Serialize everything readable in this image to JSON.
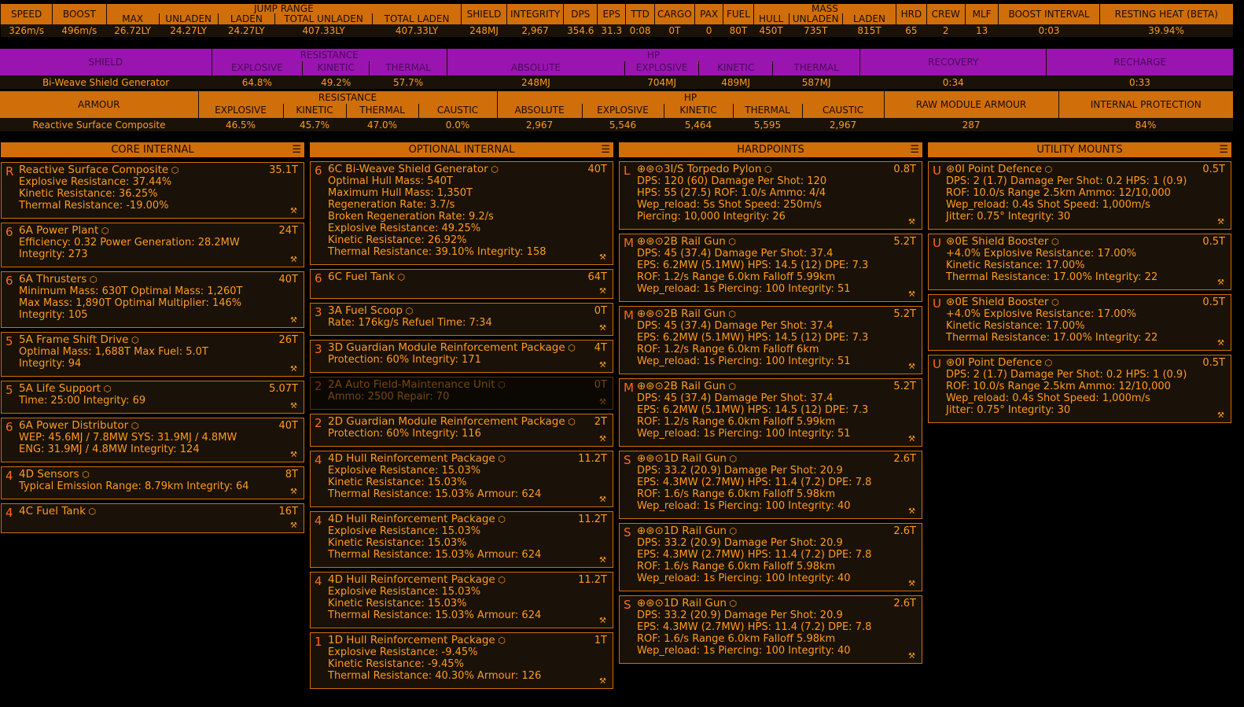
{
  "summary": {
    "group_jump": "JUMP RANGE",
    "group_mass": "MASS",
    "headers": [
      "SPEED",
      "BOOST",
      "MAX",
      "UNLADEN",
      "LADEN",
      "TOTAL UNLADEN",
      "TOTAL LADEN",
      "SHIELD",
      "INTEGRITY",
      "DPS",
      "EPS",
      "TTD",
      "CARGO",
      "PAX",
      "FUEL",
      "HULL",
      "UNLADEN",
      "LADEN",
      "HRD",
      "CREW",
      "MLF",
      "BOOST INTERVAL",
      "RESTING HEAT (BETA)"
    ],
    "values": [
      "326m/s",
      "496m/s",
      "26.72LY",
      "24.27LY",
      "24.27LY",
      "407.33LY",
      "407.33LY",
      "248MJ",
      "2,967",
      "354.6",
      "31.3",
      "0:08",
      "0T",
      "0",
      "80T",
      "450T",
      "735T",
      "815T",
      "65",
      "2",
      "13",
      "0:03",
      "39.94%"
    ]
  },
  "shield": {
    "label": "SHIELD",
    "resistance": "RESISTANCE",
    "hp": "HP",
    "recovery": "RECOVERY",
    "recharge": "RECHARGE",
    "sub": [
      "EXPLOSIVE",
      "KINETIC",
      "THERMAL",
      "ABSOLUTE",
      "EXPLOSIVE",
      "KINETIC",
      "THERMAL"
    ],
    "name": "Bi-Weave Shield Generator",
    "values": [
      "64.8%",
      "49.2%",
      "57.7%",
      "248MJ",
      "704MJ",
      "489MJ",
      "587MJ",
      "0:34",
      "0:33"
    ]
  },
  "armour": {
    "label": "ARMOUR",
    "resistance": "RESISTANCE",
    "hp": "HP",
    "raw": "RAW MODULE ARMOUR",
    "internal": "INTERNAL PROTECTION",
    "sub": [
      "EXPLOSIVE",
      "KINETIC",
      "THERMAL",
      "CAUSTIC",
      "ABSOLUTE",
      "EXPLOSIVE",
      "KINETIC",
      "THERMAL",
      "CAUSTIC"
    ],
    "name": "Reactive Surface Composite",
    "values": [
      "46.5%",
      "45.7%",
      "47.0%",
      "0.0%",
      "2,967",
      "5,546",
      "5,464",
      "5,595",
      "2,967",
      "287",
      "84%"
    ]
  },
  "columns": [
    {
      "title": "CORE INTERNAL",
      "slots": [
        {
          "cls": "R",
          "name": "Reactive Surface Composite",
          "mass": "35.1T",
          "lines": [
            "Explosive Resistance: 37.44%",
            "Kinetic Resistance: 36.25%",
            "Thermal Resistance: -19.00%"
          ]
        },
        {
          "cls": "6",
          "name": "6A Power Plant",
          "mass": "24T",
          "lines": [
            "Efficiency: 0.32   Power Generation: 28.2MW",
            "Integrity: 273"
          ]
        },
        {
          "cls": "6",
          "name": "6A Thrusters",
          "mass": "40T",
          "lines": [
            "Minimum Mass: 630T   Optimal Mass: 1,260T",
            "Max Mass: 1,890T   Optimal Multiplier: 146%",
            "Integrity: 105"
          ]
        },
        {
          "cls": "5",
          "name": "5A Frame Shift Drive",
          "mass": "26T",
          "lines": [
            "Optimal Mass: 1,688T   Max Fuel: 5.0T",
            "Integrity: 94"
          ]
        },
        {
          "cls": "5",
          "name": "5A Life Support",
          "mass": "5.07T",
          "lines": [
            "Time: 25:00   Integrity: 69"
          ]
        },
        {
          "cls": "6",
          "name": "6A Power Distributor",
          "mass": "40T",
          "lines": [
            "WEP: 45.6MJ / 7.8MW   SYS: 31.9MJ / 4.8MW",
            "ENG: 31.9MJ / 4.8MW   Integrity: 124"
          ]
        },
        {
          "cls": "4",
          "name": "4D Sensors",
          "mass": "8T",
          "lines": [
            "Typical Emission Range: 8.79km   Integrity: 64"
          ]
        },
        {
          "cls": "4",
          "name": "4C Fuel Tank",
          "mass": "16T",
          "lines": []
        }
      ]
    },
    {
      "title": "OPTIONAL INTERNAL",
      "slots": [
        {
          "cls": "6",
          "name": "6C Bi-Weave Shield Generator",
          "mass": "40T",
          "lines": [
            "Optimal Hull Mass: 540T",
            "Maximum Hull Mass: 1,350T",
            "Regeneration Rate: 3.7/s",
            "Broken Regeneration Rate: 9.2/s",
            "Explosive Resistance: 49.25%",
            "Kinetic Resistance: 26.92%",
            "Thermal Resistance: 39.10%   Integrity: 158"
          ]
        },
        {
          "cls": "6",
          "name": "6C Fuel Tank",
          "mass": "64T",
          "lines": []
        },
        {
          "cls": "3",
          "name": "3A Fuel Scoop",
          "mass": "0T",
          "lines": [
            "Rate: 176kg/s   Refuel Time: 7:34"
          ]
        },
        {
          "cls": "3",
          "name": "3D Guardian Module Reinforcement Package",
          "mass": "4T",
          "lines": [
            "Protection: 60%   Integrity: 171"
          ]
        },
        {
          "cls": "2",
          "name": "2A Auto Field-Maintenance Unit",
          "mass": "0T",
          "dim": true,
          "lines": [
            "Ammo: 2500   Repair: 70"
          ]
        },
        {
          "cls": "2",
          "name": "2D Guardian Module Reinforcement Package",
          "mass": "2T",
          "lines": [
            "Protection: 60%   Integrity: 116"
          ]
        },
        {
          "cls": "4",
          "name": "4D Hull Reinforcement Package",
          "mass": "11.2T",
          "lines": [
            "Explosive Resistance: 15.03%",
            "Kinetic Resistance: 15.03%",
            "Thermal Resistance: 15.03%   Armour: 624"
          ]
        },
        {
          "cls": "4",
          "name": "4D Hull Reinforcement Package",
          "mass": "11.2T",
          "lines": [
            "Explosive Resistance: 15.03%",
            "Kinetic Resistance: 15.03%",
            "Thermal Resistance: 15.03%   Armour: 624"
          ]
        },
        {
          "cls": "4",
          "name": "4D Hull Reinforcement Package",
          "mass": "11.2T",
          "lines": [
            "Explosive Resistance: 15.03%",
            "Kinetic Resistance: 15.03%",
            "Thermal Resistance: 15.03%   Armour: 624"
          ]
        },
        {
          "cls": "1",
          "name": "1D Hull Reinforcement Package",
          "mass": "1T",
          "lines": [
            "Explosive Resistance: -9.45%",
            "Kinetic Resistance: -9.45%",
            "Thermal Resistance: 40.30%   Armour: 126"
          ]
        }
      ]
    },
    {
      "title": "HARDPOINTS",
      "slots": [
        {
          "cls": "L",
          "name": "3I/S Torpedo Pylon",
          "mass": "0.8T",
          "lines": [
            "DPS: 120 (60)   Damage Per Shot: 120",
            "HPS: 55 (27.5)   ROF: 1.0/s   Ammo: 4/4",
            "Wep_reload: 5s   Shot Speed: 250m/s",
            "Piercing: 10,000   Integrity: 26"
          ]
        },
        {
          "cls": "M",
          "name": "2B Rail Gun",
          "mass": "5.2T",
          "lines": [
            "DPS: 45 (37.4)   Damage Per Shot: 37.4",
            "EPS: 6.2MW (5.1MW)   HPS: 14.5 (12)   DPE: 7.3",
            "ROF: 1.2/s   Range 6.0km   Falloff 5.99km",
            "Wep_reload: 1s   Piercing: 100   Integrity: 51"
          ]
        },
        {
          "cls": "M",
          "name": "2B Rail Gun",
          "mass": "5.2T",
          "lines": [
            "DPS: 45 (37.4)   Damage Per Shot: 37.4",
            "EPS: 6.2MW (5.1MW)   HPS: 14.5 (12)   DPE: 7.3",
            "ROF: 1.2/s   Range 6.0km   Falloff 6km",
            "Wep_reload: 1s   Piercing: 100   Integrity: 51"
          ]
        },
        {
          "cls": "M",
          "name": "2B Rail Gun",
          "mass": "5.2T",
          "lines": [
            "DPS: 45 (37.4)   Damage Per Shot: 37.4",
            "EPS: 6.2MW (5.1MW)   HPS: 14.5 (12)   DPE: 7.3",
            "ROF: 1.2/s   Range 6.0km   Falloff 5.99km",
            "Wep_reload: 1s   Piercing: 100   Integrity: 51"
          ]
        },
        {
          "cls": "S",
          "name": "1D Rail Gun",
          "mass": "2.6T",
          "lines": [
            "DPS: 33.2 (20.9)   Damage Per Shot: 20.9",
            "EPS: 4.3MW (2.7MW)   HPS: 11.4 (7.2)   DPE: 7.8",
            "ROF: 1.6/s   Range 6.0km   Falloff 5.98km",
            "Wep_reload: 1s   Piercing: 100   Integrity: 40"
          ]
        },
        {
          "cls": "S",
          "name": "1D Rail Gun",
          "mass": "2.6T",
          "lines": [
            "DPS: 33.2 (20.9)   Damage Per Shot: 20.9",
            "EPS: 4.3MW (2.7MW)   HPS: 11.4 (7.2)   DPE: 7.8",
            "ROF: 1.6/s   Range 6.0km   Falloff 5.98km",
            "Wep_reload: 1s   Piercing: 100   Integrity: 40"
          ]
        },
        {
          "cls": "S",
          "name": "1D Rail Gun",
          "mass": "2.6T",
          "lines": [
            "DPS: 33.2 (20.9)   Damage Per Shot: 20.9",
            "EPS: 4.3MW (2.7MW)   HPS: 11.4 (7.2)   DPE: 7.8",
            "ROF: 1.6/s   Range 6.0km   Falloff 5.98km",
            "Wep_reload: 1s   Piercing: 100   Integrity: 40"
          ]
        }
      ]
    },
    {
      "title": "UTILITY MOUNTS",
      "slots": [
        {
          "cls": "U",
          "name": "0I Point Defence",
          "mass": "0.5T",
          "lines": [
            "DPS: 2 (1.7)   Damage Per Shot: 0.2   HPS: 1 (0.9)",
            "ROF: 10.0/s   Range 2.5km   Ammo: 12/10,000",
            "Wep_reload: 0.4s   Shot Speed: 1,000m/s",
            "Jitter: 0.75°   Integrity: 30"
          ]
        },
        {
          "cls": "U",
          "name": "0E Shield Booster",
          "mass": "0.5T",
          "lines": [
            "+4.0%   Explosive Resistance: 17.00%",
            "Kinetic Resistance: 17.00%",
            "Thermal Resistance: 17.00%   Integrity: 22"
          ]
        },
        {
          "cls": "U",
          "name": "0E Shield Booster",
          "mass": "0.5T",
          "lines": [
            "+4.0%   Explosive Resistance: 17.00%",
            "Kinetic Resistance: 17.00%",
            "Thermal Resistance: 17.00%   Integrity: 22"
          ]
        },
        {
          "cls": "U",
          "name": "0I Point Defence",
          "mass": "0.5T",
          "lines": [
            "DPS: 2 (1.7)   Damage Per Shot: 0.2   HPS: 1 (0.9)",
            "ROF: 10.0/s   Range 2.5km   Ammo: 12/10,000",
            "Wep_reload: 0.4s   Shot Speed: 1,000m/s",
            "Jitter: 0.75°   Integrity: 30"
          ]
        }
      ]
    }
  ]
}
